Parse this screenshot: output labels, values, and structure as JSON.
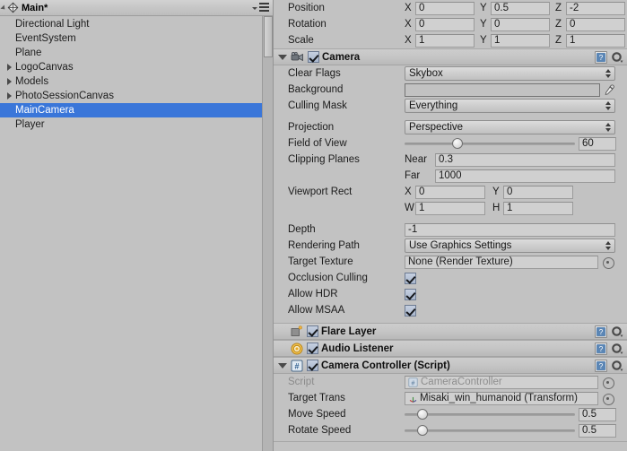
{
  "hierarchy": {
    "title": "Main*",
    "scene_icon": "unity-logo-icon",
    "menu_icon": "hamburger-menu-icon",
    "items": [
      {
        "label": "Directional Light",
        "expandable": false,
        "selected": false
      },
      {
        "label": "EventSystem",
        "expandable": false,
        "selected": false
      },
      {
        "label": "Plane",
        "expandable": false,
        "selected": false
      },
      {
        "label": "LogoCanvas",
        "expandable": true,
        "selected": false
      },
      {
        "label": "Models",
        "expandable": true,
        "selected": false
      },
      {
        "label": "PhotoSessionCanvas",
        "expandable": true,
        "selected": false
      },
      {
        "label": "MainCamera",
        "expandable": false,
        "selected": true
      },
      {
        "label": "Player",
        "expandable": false,
        "selected": false
      }
    ],
    "selection_color": "#3a76d9"
  },
  "inspector": {
    "transform": {
      "rows": [
        {
          "label": "Position",
          "x": "0",
          "y": "0.5",
          "z": "-2"
        },
        {
          "label": "Rotation",
          "x": "0",
          "y": "0",
          "z": "0"
        },
        {
          "label": "Scale",
          "x": "1",
          "y": "1",
          "z": "1"
        }
      ],
      "axis_x": "X",
      "axis_y": "Y",
      "axis_z": "Z"
    },
    "camera": {
      "title": "Camera",
      "enabled": true,
      "icon": "camera-icon",
      "help_icon": "help-book-icon",
      "settings_icon": "gear-icon",
      "clear_flags": {
        "label": "Clear Flags",
        "value": "Skybox"
      },
      "background": {
        "label": "Background",
        "color": "#2f4a71",
        "alpha_color": "#000000",
        "picker_icon": "eyedropper-icon"
      },
      "culling_mask": {
        "label": "Culling Mask",
        "value": "Everything"
      },
      "projection": {
        "label": "Projection",
        "value": "Perspective"
      },
      "field_of_view": {
        "label": "Field of View",
        "value": "60",
        "slider_pct": 30
      },
      "clipping_planes": {
        "label": "Clipping Planes",
        "near_label": "Near",
        "near": "0.3",
        "far_label": "Far",
        "far": "1000"
      },
      "viewport_rect": {
        "label": "Viewport Rect",
        "x_label": "X",
        "x": "0",
        "y_label": "Y",
        "y": "0",
        "w_label": "W",
        "w": "1",
        "h_label": "H",
        "h": "1"
      },
      "depth": {
        "label": "Depth",
        "value": "-1"
      },
      "rendering_path": {
        "label": "Rendering Path",
        "value": "Use Graphics Settings"
      },
      "target_texture": {
        "label": "Target Texture",
        "value": "None (Render Texture)"
      },
      "occlusion_culling": {
        "label": "Occlusion Culling",
        "checked": true
      },
      "allow_hdr": {
        "label": "Allow HDR",
        "checked": true
      },
      "allow_msaa": {
        "label": "Allow MSAA",
        "checked": true
      }
    },
    "flare_layer": {
      "title": "Flare Layer",
      "enabled": true,
      "icon": "flare-layer-icon",
      "help_icon": "help-book-icon",
      "settings_icon": "gear-icon"
    },
    "audio_listener": {
      "title": "Audio Listener",
      "enabled": true,
      "icon": "audio-listener-icon",
      "help_icon": "help-book-icon",
      "settings_icon": "gear-icon"
    },
    "camera_controller": {
      "title": "Camera Controller (Script)",
      "enabled": true,
      "icon": "csharp-script-icon",
      "help_icon": "help-book-icon",
      "settings_icon": "gear-icon",
      "script": {
        "label": "Script",
        "value": "CameraController",
        "icon": "csharp-script-icon"
      },
      "target_trans": {
        "label": "Target Trans",
        "value": "Misaki_win_humanoid (Transform)",
        "icon": "transform-icon"
      },
      "move_speed": {
        "label": "Move Speed",
        "value": "0.5",
        "slider_pct": 8
      },
      "rotate_speed": {
        "label": "Rotate Speed",
        "value": "0.5",
        "slider_pct": 8
      }
    }
  }
}
